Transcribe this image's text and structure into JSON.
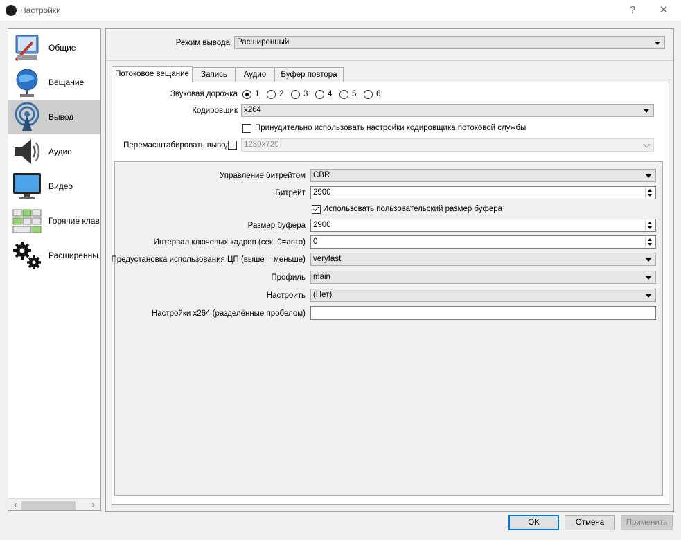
{
  "window": {
    "title": "Настройки",
    "help_glyph": "?",
    "close_glyph": "✕"
  },
  "sidebar": {
    "items": [
      {
        "label": "Общие",
        "icon": "general-icon"
      },
      {
        "label": "Вещание",
        "icon": "stream-icon"
      },
      {
        "label": "Вывод",
        "icon": "output-icon",
        "selected": true
      },
      {
        "label": "Аудио",
        "icon": "audio-icon"
      },
      {
        "label": "Видео",
        "icon": "video-icon"
      },
      {
        "label": "Горячие клав",
        "icon": "hotkeys-icon"
      },
      {
        "label": "Расширенны",
        "icon": "advanced-icon"
      }
    ],
    "scroll_left": "‹",
    "scroll_right": "›"
  },
  "output_mode": {
    "label": "Режим вывода",
    "value": "Расширенный"
  },
  "tabs": [
    {
      "label": "Потоковое вещание",
      "active": true
    },
    {
      "label": "Запись"
    },
    {
      "label": "Аудио"
    },
    {
      "label": "Буфер повтора"
    }
  ],
  "stream": {
    "audio_track_label": "Звуковая дорожка",
    "audio_tracks": [
      "1",
      "2",
      "3",
      "4",
      "5",
      "6"
    ],
    "audio_track_selected": "1",
    "encoder_label": "Кодировщик",
    "encoder_value": "x264",
    "enforce_label": "Принудительно использовать настройки кодировщика потоковой службы",
    "enforce_checked": false,
    "rescale_label": "Перемасштабировать вывод",
    "rescale_checked": false,
    "rescale_value": "1280x720"
  },
  "encoder": {
    "rate_control_label": "Управление битрейтом",
    "rate_control_value": "CBR",
    "bitrate_label": "Битрейт",
    "bitrate_value": "2900",
    "custom_buffer_label": "Использовать пользовательский размер буфера",
    "custom_buffer_checked": true,
    "buffer_size_label": "Размер буфера",
    "buffer_size_value": "2900",
    "keyframe_label": "Интервал ключевых кадров (сек, 0=авто)",
    "keyframe_value": "0",
    "preset_label": "Предустановка использования ЦП (выше = меньше)",
    "preset_value": "veryfast",
    "profile_label": "Профиль",
    "profile_value": "main",
    "tune_label": "Настроить",
    "tune_value": "(Нет)",
    "x264opts_label": "Настройки x264 (разделённые пробелом)",
    "x264opts_value": ""
  },
  "buttons": {
    "ok": "OK",
    "cancel": "Отмена",
    "apply": "Применить"
  }
}
